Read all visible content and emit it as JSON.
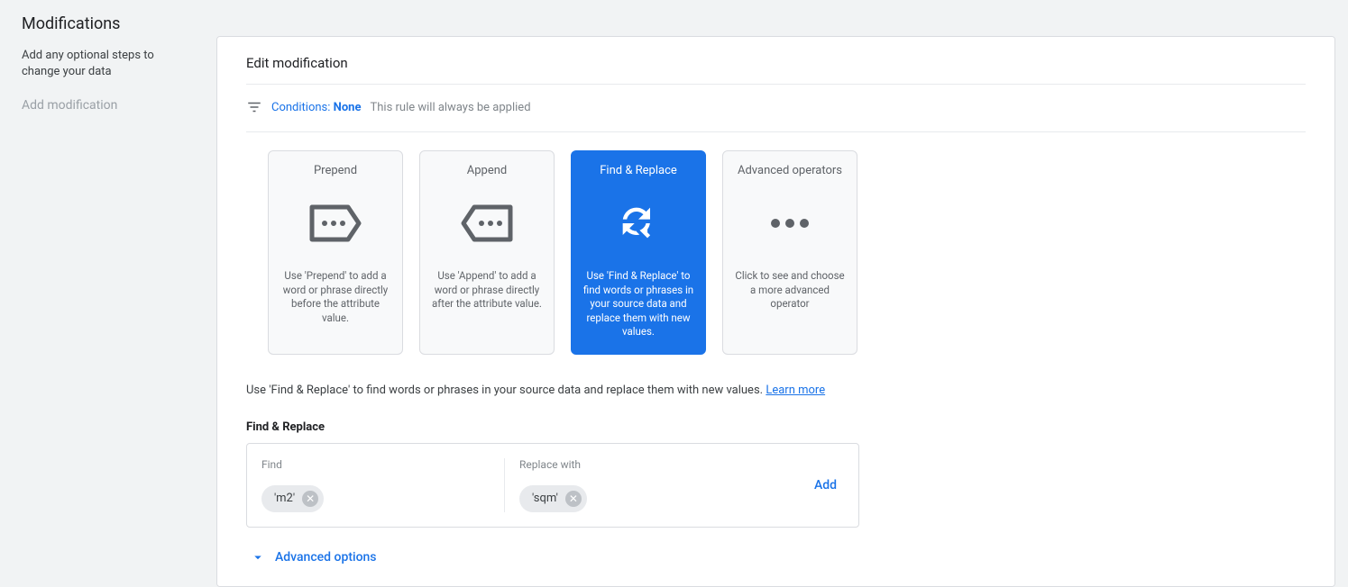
{
  "sidebar": {
    "title": "Modifications",
    "description": "Add any optional steps to change your data",
    "add_label": "Add modification"
  },
  "main": {
    "title": "Edit modification",
    "conditions": {
      "prefix": "Conditions:",
      "value": "None",
      "note": "This rule will always be applied"
    },
    "cards": [
      {
        "title": "Prepend",
        "desc": "Use 'Prepend' to add a word or phrase directly before the attribute value.",
        "active": false
      },
      {
        "title": "Append",
        "desc": "Use 'Append' to add a word or phrase directly after the attribute value.",
        "active": false
      },
      {
        "title": "Find & Replace",
        "desc": "Use 'Find & Replace' to find words or phrases in your source data and replace them with new values.",
        "active": true
      },
      {
        "title": "Advanced operators",
        "desc": "Click to see and choose a more advanced operator",
        "active": false
      }
    ],
    "helper_text": "Use 'Find & Replace' to find words or phrases in your source data and replace them with new values.",
    "learn_more": "Learn more",
    "subsection_title": "Find & Replace",
    "find_label": "Find",
    "replace_label": "Replace with",
    "find_chip": "'m2'",
    "replace_chip": "'sqm'",
    "add_button": "Add",
    "advanced_options": "Advanced options"
  }
}
